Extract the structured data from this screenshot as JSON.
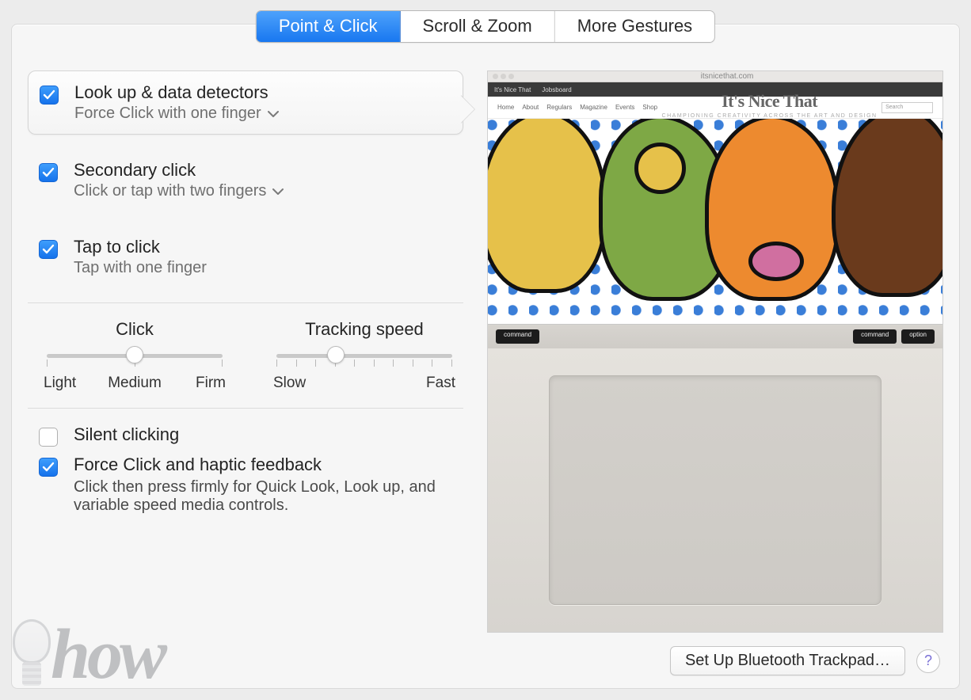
{
  "tabs": {
    "point_click": "Point & Click",
    "scroll_zoom": "Scroll & Zoom",
    "more_gestures": "More Gestures"
  },
  "options": {
    "lookup": {
      "title": "Look up & data detectors",
      "sub": "Force Click with one finger"
    },
    "secondary": {
      "title": "Secondary click",
      "sub": "Click or tap with two fingers"
    },
    "tap": {
      "title": "Tap to click",
      "sub": "Tap with one finger"
    }
  },
  "sliders": {
    "click": {
      "title": "Click",
      "left": "Light",
      "mid": "Medium",
      "right": "Firm"
    },
    "tracking": {
      "title": "Tracking speed",
      "left": "Slow",
      "right": "Fast"
    }
  },
  "bottom": {
    "silent": "Silent clicking",
    "force": "Force Click and haptic feedback",
    "force_desc": "Click then press firmly for Quick Look, Look up, and variable speed media controls."
  },
  "footer": {
    "setup": "Set Up Bluetooth Trackpad…",
    "help": "?"
  },
  "watermark": "how",
  "preview": {
    "tab1": "It's Nice That",
    "tab2": "Jobsboard",
    "nav": {
      "home": "Home",
      "about": "About",
      "regulars": "Regulars",
      "magazine": "Magazine",
      "events": "Events",
      "shop": "Shop"
    },
    "brand": "It's Nice That",
    "tagline": "CHAMPIONING CREATIVITY ACROSS THE ART AND DESIGN WORLD",
    "search": "Search",
    "url": "itsnicethat.com",
    "key_command": "command",
    "key_option": "option"
  }
}
